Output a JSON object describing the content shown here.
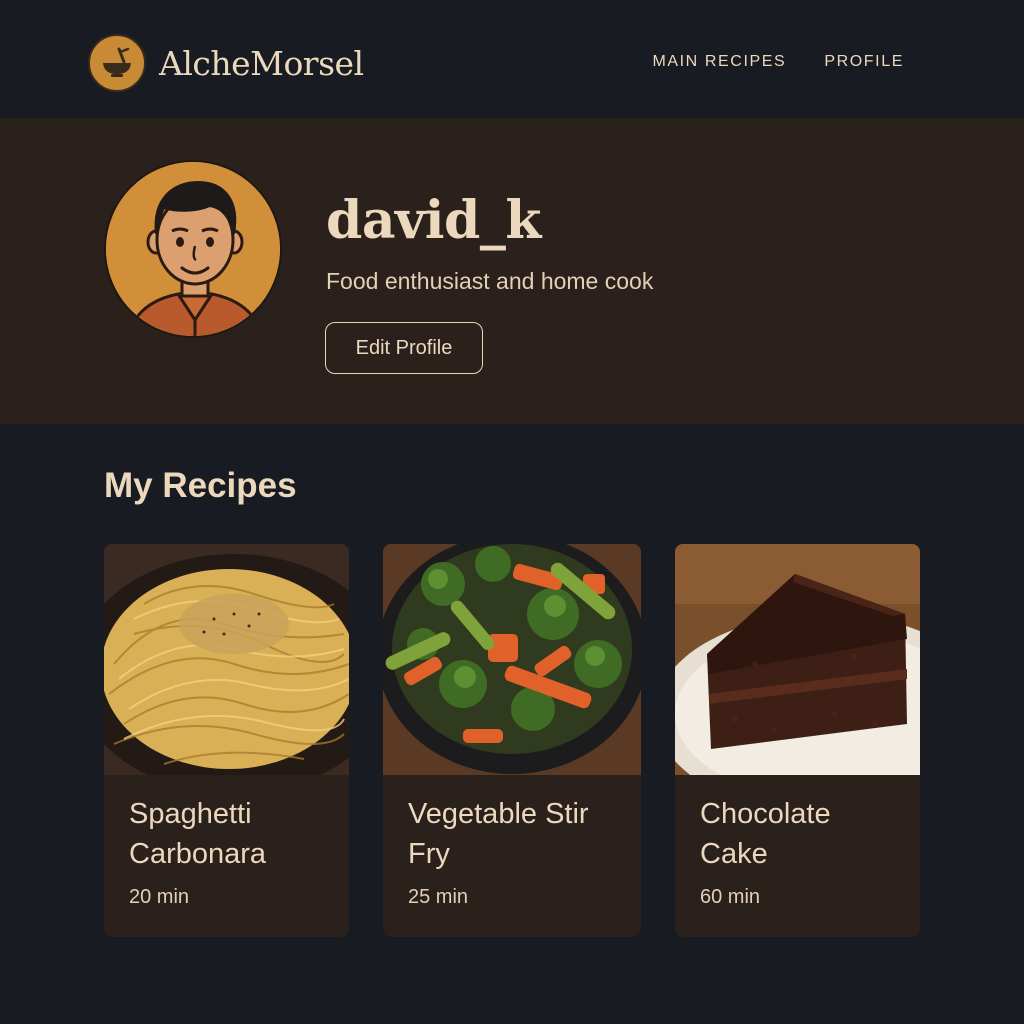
{
  "header": {
    "brand_name": "AlcheMorsel",
    "logo_icon": "bowl-icon",
    "nav": [
      {
        "label": "MAIN RECIPES"
      },
      {
        "label": "PROFILE"
      }
    ]
  },
  "profile": {
    "avatar_icon": "user-avatar",
    "username": "david_k",
    "bio": "Food enthusiast and home cook",
    "edit_label": "Edit Profile"
  },
  "recipes": {
    "title": "My Recipes",
    "items": [
      {
        "title": "Spaghetti Carbonara",
        "time": "20 min",
        "image_icon": "pasta-image"
      },
      {
        "title": "Vegetable Stir Fry",
        "time": "25 min",
        "image_icon": "stir-fry-image"
      },
      {
        "title": "Chocolate Cake",
        "time": "60 min",
        "image_icon": "cake-image"
      }
    ]
  },
  "colors": {
    "background": "#181b21",
    "band": "#2a211d",
    "text": "#ecd9bd",
    "accent": "#d18f3a"
  }
}
